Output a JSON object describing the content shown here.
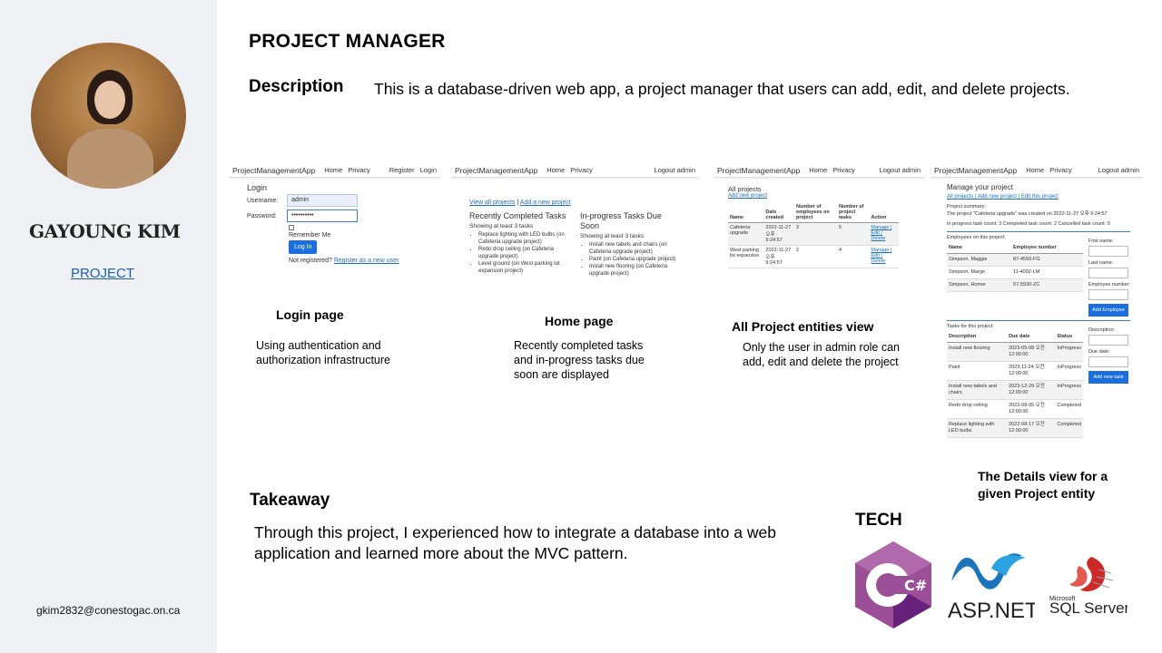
{
  "sidebar": {
    "name": "GAYOUNG KIM",
    "project_link": "PROJECT",
    "email": "gkim2832@conestogac.on.ca"
  },
  "main": {
    "title": "PROJECT MANAGER",
    "description_heading": "Description",
    "description_text": "This is a database-driven web app, a project manager that users can add, edit, and delete projects.",
    "takeaway_heading": "Takeaway",
    "takeaway_text": "Through this project, I experienced how to integrate a database into a web application and learned more about the MVC pattern.",
    "tech_heading": "TECH"
  },
  "screens": {
    "login": {
      "brand": "ProjectManagementApp",
      "nav": [
        "Home",
        "Privacy"
      ],
      "nav_right": [
        "Register",
        "Login"
      ],
      "heading": "Login",
      "username_label": "Username:",
      "username_value": "admin",
      "password_label": "Password:",
      "password_value": "••••••••••",
      "remember": "Remember Me",
      "button": "Log In",
      "not_registered": "Not registered?",
      "register_link": "Register as a new user",
      "caption_title": "Login page",
      "caption_text": "Using authentication and authorization infrastructure"
    },
    "home": {
      "brand": "ProjectManagementApp",
      "nav": [
        "Home",
        "Privacy"
      ],
      "nav_right": "Logout admin",
      "link1": "View all projects",
      "link2": "Add a new project",
      "col1_title": "Recently Completed Tasks",
      "col1_sub": "Showing at least 3 tasks",
      "col1_items": [
        "Replace lighting with LED bulbs (on Cafeteria upgrade project)",
        "Redo drop ceiling (on Cafeteria upgrade project)",
        "Level ground (on West parking lot expansion project)"
      ],
      "col2_title": "In-progress Tasks Due Soon",
      "col2_sub": "Showing at least 3 tasks",
      "col2_items": [
        "Install new tabels and chairs (on Cafeteria upgrade project)",
        "Paint (on Cafeteria upgrade project)",
        "Install new flooring (on Cafeteria upgrade project)"
      ],
      "caption_title": "Home page",
      "caption_text": "Recently completed tasks and in-progress tasks due soon are displayed"
    },
    "projects": {
      "brand": "ProjectManagementApp",
      "nav": [
        "Home",
        "Privacy"
      ],
      "nav_right": "Logout admin",
      "heading": "All projects",
      "add_link": "Add new project",
      "headers": [
        "Name",
        "Date created",
        "Number of employees on project",
        "Number of project tasks",
        "Action"
      ],
      "rows": [
        {
          "name": "Cafeteria upgrade",
          "date": "2022-11-27 오후 9:24:57",
          "employees": "3",
          "tasks": "5",
          "actions": "Manage | Edit | Delete"
        },
        {
          "name": "West parking lot expansion",
          "date": "2022-11-27 오후 9:24:57",
          "employees": "2",
          "tasks": "4",
          "actions": "Manage | Edit | Delete"
        }
      ],
      "caption_title": "All  Project entities view",
      "caption_text": "Only the user in admin role can add, edit and delete the project"
    },
    "details": {
      "brand": "ProjectManagementApp",
      "nav": [
        "Home",
        "Privacy"
      ],
      "nav_right": "Logout admin",
      "heading": "Manage your project",
      "links": "All projects  |  Add new project  |  Edit this project",
      "summary_label": "Project summary:",
      "summary_created": "The project \"Cafeteria upgrade\" was created on 2022-11-27 오후 9:24:57",
      "summary_counts": "In progress task count: 3 Completed task count: 2 Cancelled task count: 0",
      "employees_caption": "Employees on this project:",
      "employee_headers": [
        "Name",
        "Employee number"
      ],
      "employees": [
        {
          "name": "Simpson, Maggie",
          "num": "87-4559-FG"
        },
        {
          "name": "Simpson, Marge",
          "num": "11-4092-LM"
        },
        {
          "name": "Simpson, Homer",
          "num": "57-5930-ZC"
        }
      ],
      "emp_form": [
        "First name:",
        "Last name:",
        "Employee number:"
      ],
      "emp_button": "Add Employee",
      "tasks_caption": "Tasks for this project:",
      "task_headers": [
        "Description",
        "Due date",
        "Status"
      ],
      "tasks": [
        {
          "desc": "Install new flooring",
          "due": "2023-05-08 오전 12:00:00",
          "status": "InProgress"
        },
        {
          "desc": "Paint",
          "due": "2023-11-24 오전 12:00:00",
          "status": "InProgress"
        },
        {
          "desc": "Install new tabels and chairs",
          "due": "2023-12-29 오전 12:00:00",
          "status": "InProgress"
        },
        {
          "desc": "Redo drop ceiling",
          "due": "2022-08-05 오전 12:00:00",
          "status": "Completed"
        },
        {
          "desc": "Replace lighting with LED bulbs",
          "due": "2022-08-17 오전 12:00:00",
          "status": "Completed"
        }
      ],
      "task_form": [
        "Description:",
        "Due date:"
      ],
      "task_button": "Add new task",
      "caption_title": "The Details view for a given Project entity"
    }
  },
  "tech": {
    "logos": [
      {
        "icon": "csharp-logo",
        "label": "C#",
        "color": "#68217a"
      },
      {
        "icon": "aspnet-logo",
        "label": "ASP.NET",
        "color": "#1c75bc"
      },
      {
        "icon": "sqlserver-logo",
        "label": "SQL Server",
        "sublabel": "Microsoft",
        "color": "#cc2927"
      }
    ]
  }
}
